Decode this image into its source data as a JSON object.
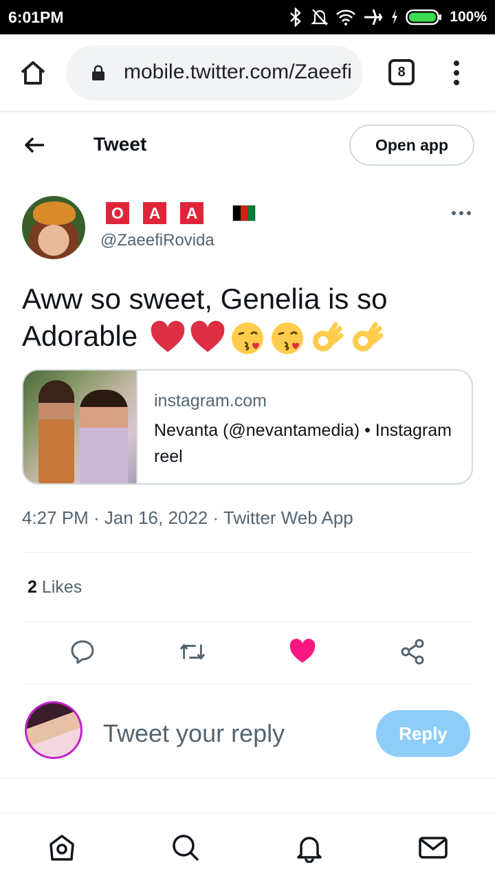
{
  "status_bar": {
    "time": "6:01PM",
    "battery": "100%",
    "icons": [
      "bluetooth-icon",
      "bell-off-icon",
      "wifi-icon",
      "airplane-icon",
      "charging-icon",
      "battery-icon"
    ]
  },
  "browser": {
    "url": "mobile.twitter.com/ZaeefiRovida",
    "tab_count": "8",
    "icons": [
      "home-icon",
      "lock-icon",
      "tabs-icon",
      "more-vert-icon"
    ]
  },
  "header": {
    "title": "Tweet",
    "open_app_label": "Open app"
  },
  "tweet": {
    "display_name_badges": [
      "O",
      "A",
      "A"
    ],
    "handle": "@ZaeefiRovida",
    "text": "Aww so sweet, Genelia is so Adorable",
    "emojis": [
      "heart-emoji",
      "heart-emoji",
      "kiss-face-emoji",
      "kiss-face-emoji",
      "ok-hand-emoji",
      "ok-hand-emoji"
    ],
    "link_card": {
      "domain": "instagram.com",
      "description": "Nevanta (@nevantamedia) • Instagram reel"
    },
    "timestamp": "4:27 PM · Jan 16, 2022 · Twitter Web App",
    "likes_count": "2",
    "likes_label": "Likes",
    "colors": {
      "like_active": "#f91880",
      "badge_red": "#e0253a",
      "handle_gray": "#536471"
    }
  },
  "reply": {
    "placeholder": "Tweet your reply",
    "button_label": "Reply",
    "button_color": "#8ecdf8"
  },
  "bottom_nav": {
    "items": [
      "home-icon",
      "search-icon",
      "notifications-icon",
      "messages-icon"
    ]
  }
}
